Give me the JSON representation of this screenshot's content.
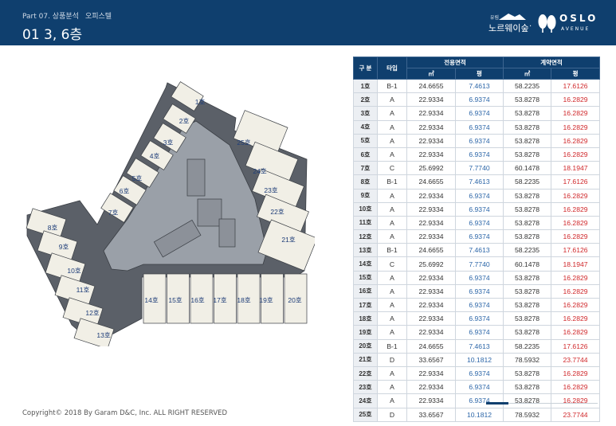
{
  "header": {
    "part": "Part 07. 상품분석",
    "section": "오피스텔",
    "title": "01 3, 6층",
    "brand": {
      "sub": "유림",
      "name_kr": "노르웨이숲",
      "name_en": "OSLO",
      "tagline": "AVENUE"
    }
  },
  "table": {
    "headers": {
      "no": "구 분",
      "type": "타입",
      "exclusive": "전용면적",
      "contract": "계약면적",
      "sqm": "㎡",
      "pyeong": "평"
    },
    "rows": [
      {
        "no": "1호",
        "type": "B-1",
        "ex_m": "24.6655",
        "ex_p": "7.4613",
        "ct_m": "58.2235",
        "ct_p": "17.6126"
      },
      {
        "no": "2호",
        "type": "A",
        "ex_m": "22.9334",
        "ex_p": "6.9374",
        "ct_m": "53.8278",
        "ct_p": "16.2829"
      },
      {
        "no": "3호",
        "type": "A",
        "ex_m": "22.9334",
        "ex_p": "6.9374",
        "ct_m": "53.8278",
        "ct_p": "16.2829"
      },
      {
        "no": "4호",
        "type": "A",
        "ex_m": "22.9334",
        "ex_p": "6.9374",
        "ct_m": "53.8278",
        "ct_p": "16.2829"
      },
      {
        "no": "5호",
        "type": "A",
        "ex_m": "22.9334",
        "ex_p": "6.9374",
        "ct_m": "53.8278",
        "ct_p": "16.2829"
      },
      {
        "no": "6호",
        "type": "A",
        "ex_m": "22.9334",
        "ex_p": "6.9374",
        "ct_m": "53.8278",
        "ct_p": "16.2829"
      },
      {
        "no": "7호",
        "type": "C",
        "ex_m": "25.6992",
        "ex_p": "7.7740",
        "ct_m": "60.1478",
        "ct_p": "18.1947"
      },
      {
        "no": "8호",
        "type": "B-1",
        "ex_m": "24.6655",
        "ex_p": "7.4613",
        "ct_m": "58.2235",
        "ct_p": "17.6126"
      },
      {
        "no": "9호",
        "type": "A",
        "ex_m": "22.9334",
        "ex_p": "6.9374",
        "ct_m": "53.8278",
        "ct_p": "16.2829"
      },
      {
        "no": "10호",
        "type": "A",
        "ex_m": "22.9334",
        "ex_p": "6.9374",
        "ct_m": "53.8278",
        "ct_p": "16.2829"
      },
      {
        "no": "11호",
        "type": "A",
        "ex_m": "22.9334",
        "ex_p": "6.9374",
        "ct_m": "53.8278",
        "ct_p": "16.2829"
      },
      {
        "no": "12호",
        "type": "A",
        "ex_m": "22.9334",
        "ex_p": "6.9374",
        "ct_m": "53.8278",
        "ct_p": "16.2829"
      },
      {
        "no": "13호",
        "type": "B-1",
        "ex_m": "24.6655",
        "ex_p": "7.4613",
        "ct_m": "58.2235",
        "ct_p": "17.6126"
      },
      {
        "no": "14호",
        "type": "C",
        "ex_m": "25.6992",
        "ex_p": "7.7740",
        "ct_m": "60.1478",
        "ct_p": "18.1947"
      },
      {
        "no": "15호",
        "type": "A",
        "ex_m": "22.9334",
        "ex_p": "6.9374",
        "ct_m": "53.8278",
        "ct_p": "16.2829"
      },
      {
        "no": "16호",
        "type": "A",
        "ex_m": "22.9334",
        "ex_p": "6.9374",
        "ct_m": "53.8278",
        "ct_p": "16.2829"
      },
      {
        "no": "17호",
        "type": "A",
        "ex_m": "22.9334",
        "ex_p": "6.9374",
        "ct_m": "53.8278",
        "ct_p": "16.2829"
      },
      {
        "no": "18호",
        "type": "A",
        "ex_m": "22.9334",
        "ex_p": "6.9374",
        "ct_m": "53.8278",
        "ct_p": "16.2829"
      },
      {
        "no": "19호",
        "type": "A",
        "ex_m": "22.9334",
        "ex_p": "6.9374",
        "ct_m": "53.8278",
        "ct_p": "16.2829"
      },
      {
        "no": "20호",
        "type": "B-1",
        "ex_m": "24.6655",
        "ex_p": "7.4613",
        "ct_m": "58.2235",
        "ct_p": "17.6126"
      },
      {
        "no": "21호",
        "type": "D",
        "ex_m": "33.6567",
        "ex_p": "10.1812",
        "ct_m": "78.5932",
        "ct_p": "23.7744"
      },
      {
        "no": "22호",
        "type": "A",
        "ex_m": "22.9334",
        "ex_p": "6.9374",
        "ct_m": "53.8278",
        "ct_p": "16.2829"
      },
      {
        "no": "23호",
        "type": "A",
        "ex_m": "22.9334",
        "ex_p": "6.9374",
        "ct_m": "53.8278",
        "ct_p": "16.2829"
      },
      {
        "no": "24호",
        "type": "A",
        "ex_m": "22.9334",
        "ex_p": "6.9374",
        "ct_m": "53.8278",
        "ct_p": "16.2829"
      },
      {
        "no": "25호",
        "type": "D",
        "ex_m": "33.6567",
        "ex_p": "10.1812",
        "ct_m": "78.5932",
        "ct_p": "23.7744"
      }
    ]
  },
  "plan": {
    "labels": [
      "1호",
      "2호",
      "3호",
      "4호",
      "5호",
      "6호",
      "7호",
      "8호",
      "9호",
      "10호",
      "11호",
      "12호",
      "13호",
      "14호",
      "15호",
      "16호",
      "17호",
      "18호",
      "19호",
      "20호",
      "21호",
      "22호",
      "23호",
      "24호",
      "25호"
    ]
  },
  "footer": {
    "copyright": "Copyright© 2018 By Garam D&C, Inc. ALL RIGHT RESERVED"
  },
  "colors": {
    "header": "#0f3f6e",
    "unit_fill": "#f1efe6",
    "corridor": "#5b6068",
    "core": "#8c9199",
    "pyeong_blue": "#2c66a8",
    "pyeong_red": "#d0282b"
  }
}
